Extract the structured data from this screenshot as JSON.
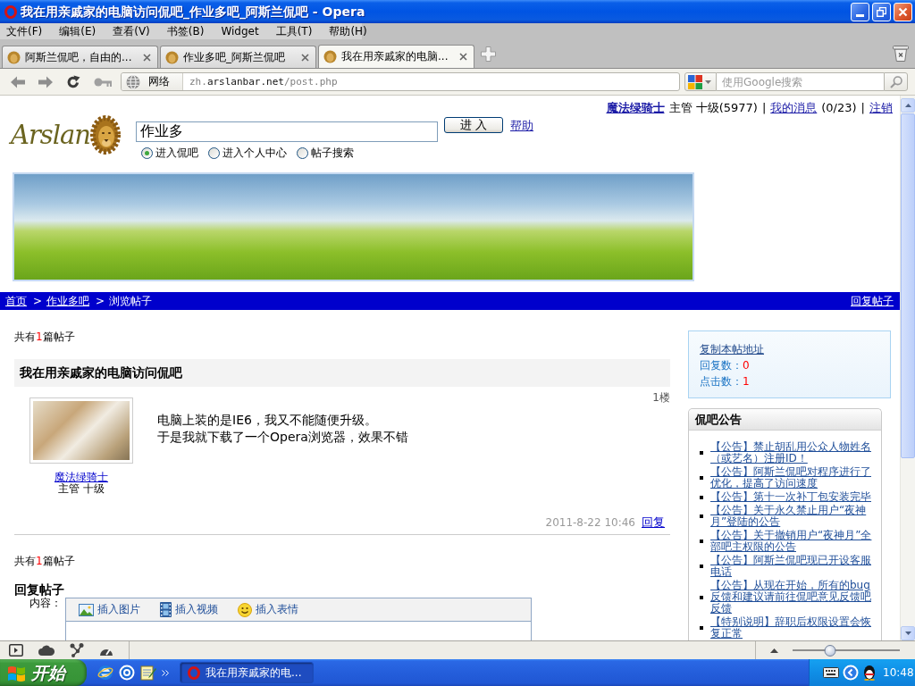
{
  "window": {
    "title": "我在用亲戚家的电脑访问侃吧_作业多吧_阿斯兰侃吧 - Opera"
  },
  "menu": [
    "文件(F)",
    "编辑(E)",
    "查看(V)",
    "书签(B)",
    "Widget",
    "工具(T)",
    "帮助(H)"
  ],
  "tabs": [
    {
      "label": "阿斯兰侃吧，自由的...",
      "selected": false
    },
    {
      "label": "作业多吧_阿斯兰侃吧",
      "selected": false
    },
    {
      "label": "我在用亲戚家的电脑...",
      "selected": true
    }
  ],
  "address_bar": {
    "zone": "网络",
    "url": {
      "prefix": "zh.",
      "domain": "arslanbar.net",
      "path": "/post.php"
    }
  },
  "web_search": {
    "placeholder": "使用Google搜索"
  },
  "page": {
    "user_bar": [
      {
        "kind": "user",
        "text": "魔法绿骑士"
      },
      {
        "kind": "text",
        "text": "主管 十级(5977)"
      },
      {
        "kind": "separator",
        "text": "|"
      },
      {
        "kind": "link",
        "text": "我的消息"
      },
      {
        "kind": "text",
        "text": "(0/23)"
      },
      {
        "kind": "separator",
        "text": "|"
      },
      {
        "kind": "link",
        "text": "注销"
      }
    ],
    "logo": "Arslan",
    "search": {
      "value": "作业多",
      "button": "进 入",
      "help": "帮助",
      "options": [
        {
          "label": "进入侃吧",
          "selected": true
        },
        {
          "label": "进入个人中心",
          "selected": false
        },
        {
          "label": "帖子搜索",
          "selected": false
        }
      ]
    },
    "breadcrumb": [
      {
        "kind": "link",
        "text": "首页"
      },
      {
        "kind": "separator",
        "text": ">"
      },
      {
        "kind": "link",
        "text": "作业多吧"
      },
      {
        "kind": "separator",
        "text": ">"
      },
      {
        "kind": "current",
        "text": "浏览帖子"
      }
    ],
    "reply_link": "回复帖子",
    "post_count_top": {
      "before": "共有",
      "count": "1",
      "after": "篇帖子"
    },
    "post": {
      "title": "我在用亲戚家的电脑访问侃吧",
      "floor": "1楼",
      "author": "魔法绿骑士",
      "author_rank": "主管 十级",
      "body": [
        "电脑上装的是IE6，我又不能随便升级。",
        "于是我就下载了一个Opera浏览器，效果不错"
      ],
      "date": "2011-8-22 10:46",
      "reply": "回复"
    },
    "post_count_bottom": {
      "before": "共有",
      "count": "1",
      "after": "篇帖子"
    },
    "reply_form": {
      "heading": "回复帖子",
      "label": "内容：",
      "tools": [
        {
          "kind": "image",
          "label": "插入图片"
        },
        {
          "kind": "video",
          "label": "插入视频"
        },
        {
          "kind": "emoji",
          "label": "插入表情"
        }
      ]
    },
    "sidebar": {
      "copy_link": "复制本帖地址",
      "stats": [
        {
          "label": "回复数：",
          "value": "0"
        },
        {
          "label": "点击数：",
          "value": "1"
        }
      ],
      "notice_title": "侃吧公告",
      "notices": [
        "【公告】禁止胡乱用公众人物姓名（或艺名）注册ID！",
        "【公告】阿斯兰侃吧对程序进行了优化，提高了访问速度",
        "【公告】第十一次补丁包安装完毕",
        "【公告】关于永久禁止用户“夜神月”登陆的公告",
        "【公告】关于撤销用户“夜神月”全部吧主权限的公告",
        "【公告】阿斯兰侃吧现已开设客服电话",
        "【公告】从现在开始，所有的bug反馈和建议请前往侃吧意见反馈吧反馈",
        "【特别说明】辞职后权限设置会恢复正常"
      ]
    }
  },
  "status_bar": {
    "zoom": {
      "level": 0.35
    }
  },
  "taskbar": {
    "start": "开始",
    "tasks": [
      {
        "label": "我在用亲戚家的电...",
        "selected": true
      }
    ],
    "clock": "10:48"
  }
}
